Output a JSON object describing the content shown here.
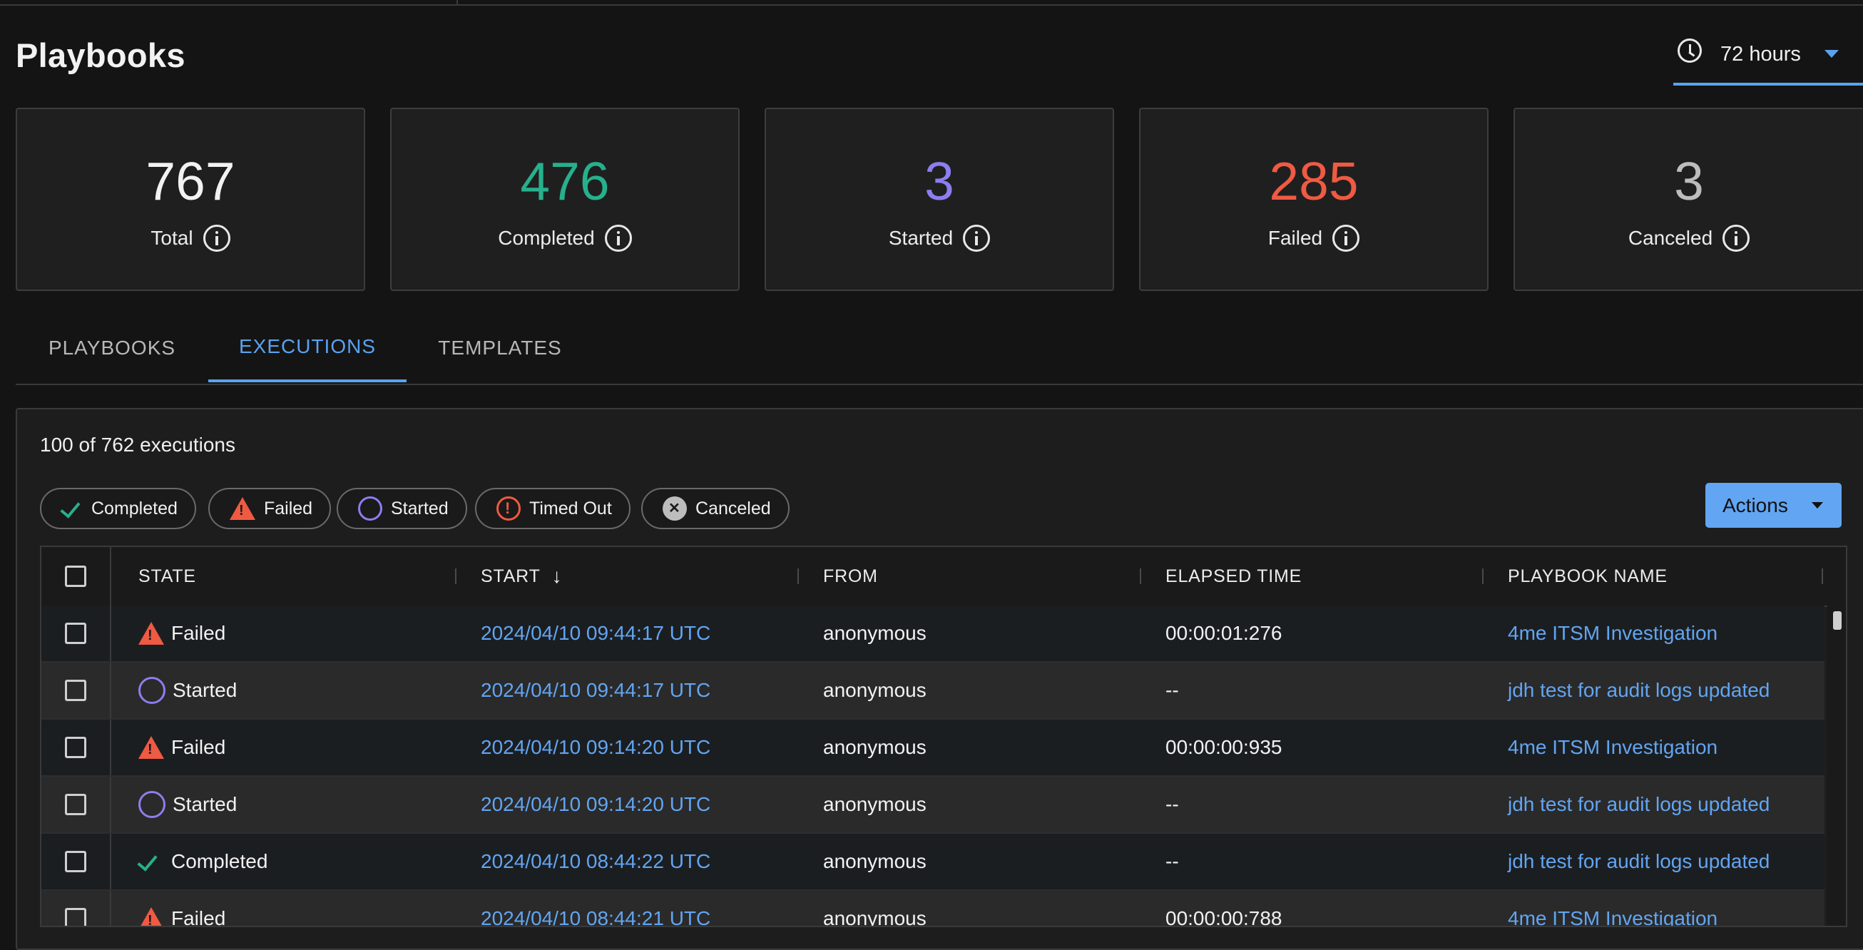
{
  "header": {
    "title": "Playbooks"
  },
  "time_range": {
    "label": "72 hours"
  },
  "stats": [
    {
      "value": "767",
      "label": "Total",
      "color": "#f2f2f2"
    },
    {
      "value": "476",
      "label": "Completed",
      "color": "#27b08c"
    },
    {
      "value": "3",
      "label": "Started",
      "color": "#8c7ef0"
    },
    {
      "value": "285",
      "label": "Failed",
      "color": "#ef5a43"
    },
    {
      "value": "3",
      "label": "Canceled",
      "color": "#bdbdbd"
    }
  ],
  "tabs": [
    {
      "label": "PLAYBOOKS",
      "active": false
    },
    {
      "label": "EXECUTIONS",
      "active": true
    },
    {
      "label": "TEMPLATES",
      "active": false
    }
  ],
  "executions": {
    "count_text": "100 of 762 executions",
    "filters": [
      {
        "label": "Completed",
        "icon": "check-icon"
      },
      {
        "label": "Failed",
        "icon": "warning-triangle-icon"
      },
      {
        "label": "Started",
        "icon": "circle-icon"
      },
      {
        "label": "Timed Out",
        "icon": "alert-circle-icon"
      },
      {
        "label": "Canceled",
        "icon": "x-circle-icon"
      }
    ],
    "actions_label": "Actions",
    "columns": [
      "STATE",
      "START",
      "FROM",
      "ELAPSED TIME",
      "PLAYBOOK NAME"
    ],
    "sort_arrow": "↓",
    "rows": [
      {
        "state": "Failed",
        "start": "2024/04/10 09:44:17 UTC",
        "from": "anonymous",
        "elapsed": "00:00:01:276",
        "playbook": "4me ITSM Investigation"
      },
      {
        "state": "Started",
        "start": "2024/04/10 09:44:17 UTC",
        "from": "anonymous",
        "elapsed": "--",
        "playbook": "jdh test for audit logs updated"
      },
      {
        "state": "Failed",
        "start": "2024/04/10 09:14:20 UTC",
        "from": "anonymous",
        "elapsed": "00:00:00:935",
        "playbook": "4me ITSM Investigation"
      },
      {
        "state": "Started",
        "start": "2024/04/10 09:14:20 UTC",
        "from": "anonymous",
        "elapsed": "--",
        "playbook": "jdh test for audit logs updated"
      },
      {
        "state": "Completed",
        "start": "2024/04/10 08:44:22 UTC",
        "from": "anonymous",
        "elapsed": "--",
        "playbook": "jdh test for audit logs updated"
      },
      {
        "state": "Failed",
        "start": "2024/04/10 08:44:21 UTC",
        "from": "anonymous",
        "elapsed": "00:00:00:788",
        "playbook": "4me ITSM Investigation"
      }
    ]
  }
}
